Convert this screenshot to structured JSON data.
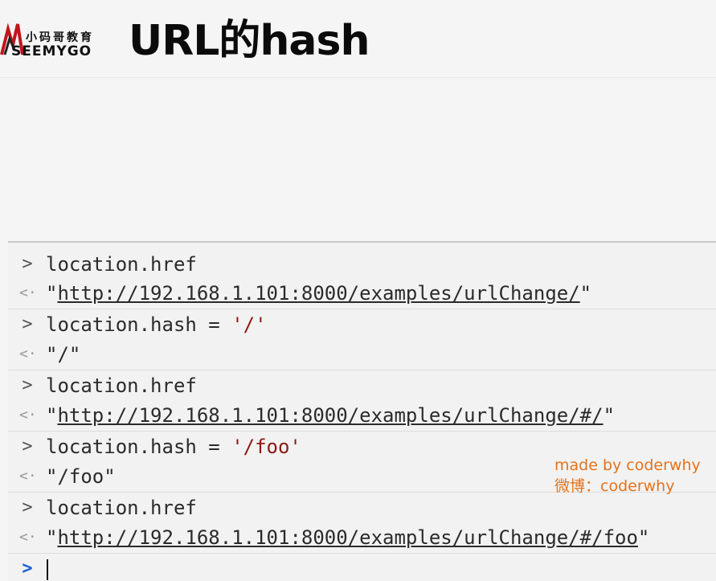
{
  "header": {
    "logo_cn": "小码哥教育",
    "logo_en": "SEEMYGO",
    "title": "URL的hash"
  },
  "console": {
    "entries": [
      {
        "type": "input",
        "code": "location.href"
      },
      {
        "type": "output",
        "value": "http://192.168.1.101:8000/examples/urlChange/"
      },
      {
        "type": "input",
        "code": "location.hash = ",
        "string": "'/'"
      },
      {
        "type": "output",
        "value": "\"/\""
      },
      {
        "type": "input",
        "code": "location.href"
      },
      {
        "type": "output",
        "value": "http://192.168.1.101:8000/examples/urlChange/#/"
      },
      {
        "type": "input",
        "code": "location.hash = ",
        "string": "'/foo'"
      },
      {
        "type": "output",
        "value": "\"/foo\""
      },
      {
        "type": "input",
        "code": "location.href"
      },
      {
        "type": "output",
        "value": "http://192.168.1.101:8000/examples/urlChange/#/foo"
      }
    ],
    "prompt_input": ">",
    "prompt_output": "<·",
    "prompt_active": ">"
  },
  "watermark": {
    "line1": "made by coderwhy",
    "line2": "微博：coderwhy"
  },
  "colors": {
    "string": "#8b1a12",
    "prompt_active": "#1a5fd1",
    "watermark": "#e4731c"
  }
}
